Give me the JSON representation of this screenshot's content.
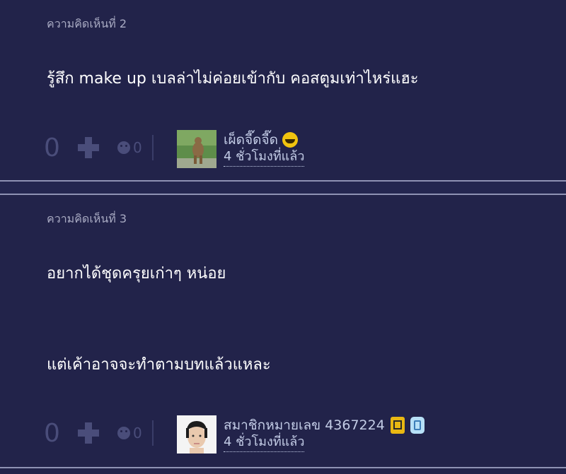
{
  "comments": [
    {
      "number_label": "ความคิดเห็นที่ 2",
      "text_lines": [
        "รู้สึก make up เบลล่าไม่ค่อยเข้ากับ คอสตูมเท่าไหร่แฮะ"
      ],
      "vote_count": "0",
      "emotion_count": "0",
      "author": "เผ็ดจี๊ดจี๊ด",
      "time": "4 ชั่วโมงที่แล้ว",
      "badges": [
        "grin-emoji-icon"
      ]
    },
    {
      "number_label": "ความคิดเห็นที่ 3",
      "text_lines": [
        "อยากได้ชุดครุยเก่าๆ หน่อย",
        "แต่เค้าอาจจะทำตามบทแล้วแหละ"
      ],
      "vote_count": "0",
      "emotion_count": "0",
      "author": "สมาชิกหมายเลข 4367224",
      "time": "4 ชั่วโมงที่แล้ว",
      "badges": [
        "phone-badge-icon",
        "blue-badge-icon"
      ]
    }
  ],
  "colors": {
    "background": "#22234a",
    "divider": "#8f92b4",
    "muted": "#4a4d7a",
    "author_text": "#c3cce6"
  }
}
